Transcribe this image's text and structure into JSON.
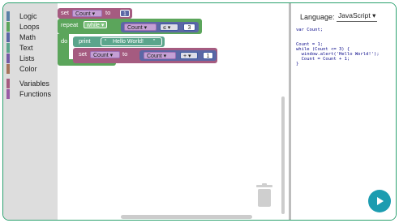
{
  "toolbox": {
    "categories": [
      {
        "label": "Logic",
        "color": "#5b80a5"
      },
      {
        "label": "Loops",
        "color": "#5ba55b"
      },
      {
        "label": "Math",
        "color": "#5b67a5"
      },
      {
        "label": "Text",
        "color": "#5ba58c"
      },
      {
        "label": "Lists",
        "color": "#745ba5"
      },
      {
        "label": "Color",
        "color": "#a5745b"
      },
      {
        "label": "Variables",
        "color": "#a55b80"
      },
      {
        "label": "Functions",
        "color": "#995ba5"
      }
    ]
  },
  "blocks": {
    "set1": {
      "set": "set",
      "var": "Count",
      "to": "to",
      "value": "1"
    },
    "repeat": {
      "label": "repeat",
      "mode": "while",
      "cond_var": "Count",
      "cond_op": "≤",
      "cond_value": "3"
    },
    "do": {
      "label": "do"
    },
    "print": {
      "label": "print",
      "text": "Hello World!",
      "open_quote": "“",
      "close_quote": "”"
    },
    "set2": {
      "set": "set",
      "var": "Count",
      "to": "to",
      "expr_var": "Count",
      "expr_op": "+",
      "expr_value": "1"
    }
  },
  "code_panel": {
    "language_label": "Language:",
    "language_value": "JavaScript",
    "code": "var Count;\n\n\nCount = 1;\nwhile (Count <= 3) {\n  window.alert('Hello World!');\n  Count = Count + 1;\n}"
  },
  "icons": {
    "trash": "trash-icon",
    "run": "play-icon",
    "dropdown": "dropdown-arrow-icon"
  },
  "colors": {
    "variables": "#a55b80",
    "loops": "#5ba55b",
    "math": "#5b67a5",
    "text": "#5ba58c",
    "run_button": "#1c9cb0"
  }
}
